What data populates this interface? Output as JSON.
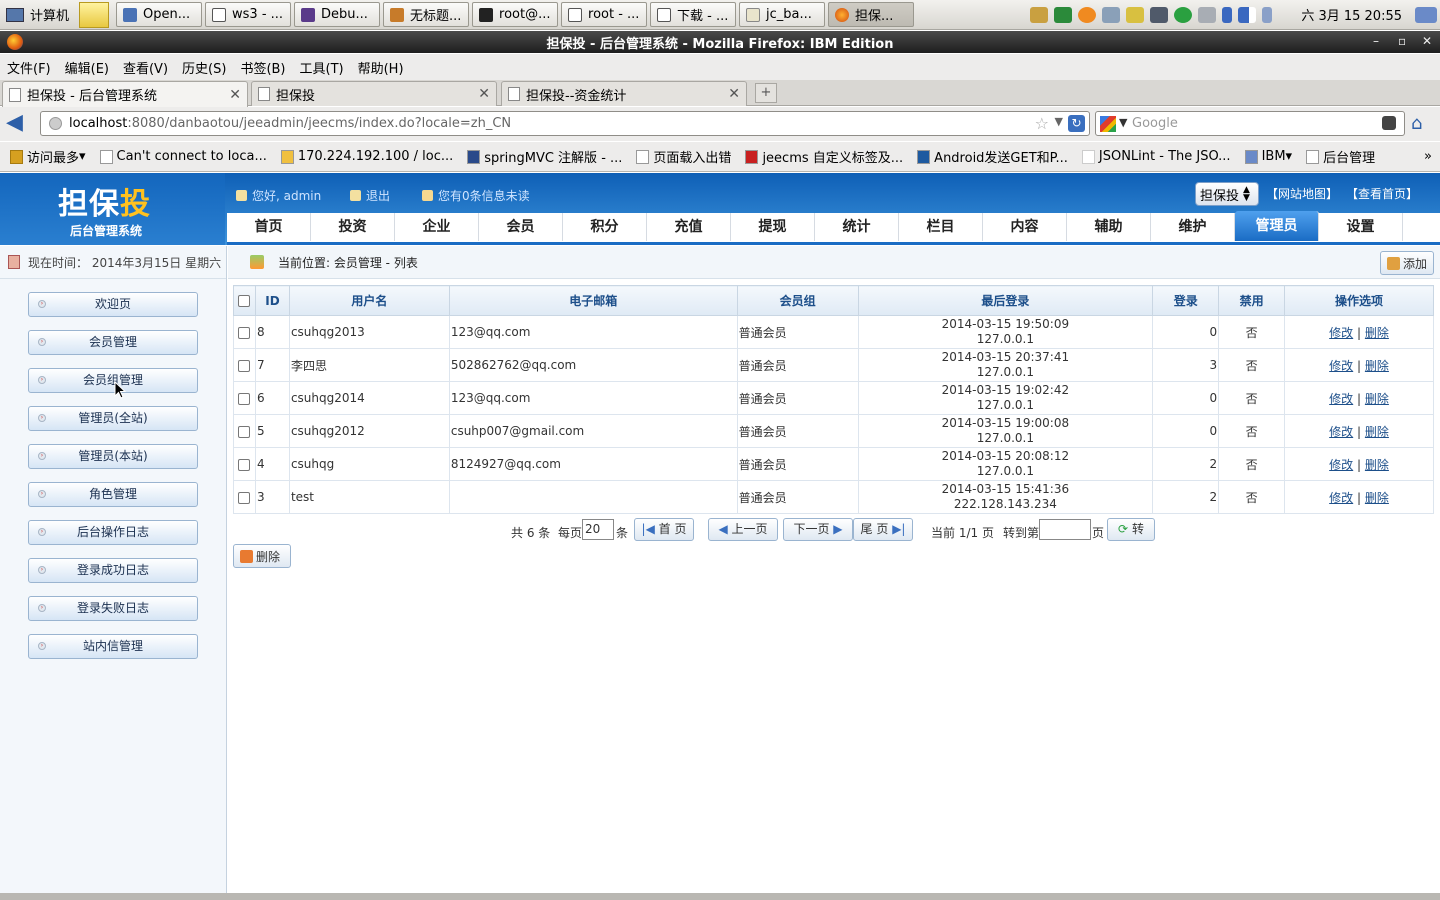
{
  "panel": {
    "computer": "计算机",
    "tasks": [
      "Open...",
      "ws3 - ...",
      "Debu...",
      "无标题...",
      "root@...",
      "root - ...",
      "下载 - ...",
      "jc_ba...",
      "担保..."
    ],
    "clock": "六 3月 15 20:55"
  },
  "window": {
    "title": "担保投 - 后台管理系统 - Mozilla Firefox: IBM Edition"
  },
  "menu": [
    "文件(F)",
    "编辑(E)",
    "查看(V)",
    "历史(S)",
    "书签(B)",
    "工具(T)",
    "帮助(H)"
  ],
  "tabs": [
    "担保投 - 后台管理系统",
    "担保投",
    "担保投--资金统计"
  ],
  "address": {
    "host": "localhost",
    "rest": ":8080/danbaotou/jeeadmin/jeecms/index.do?locale=zh_CN"
  },
  "search": {
    "placeholder": "Google"
  },
  "bookmarks": [
    "访问最多",
    "Can't connect to loca...",
    "170.224.192.100 / loc...",
    "springMVC 注解版 - ...",
    "页面载入出错",
    "jeecms 自定义标签及...",
    "Android发送GET和P...",
    "JSONLint - The JSO...",
    "IBM",
    "后台管理"
  ],
  "header": {
    "logo_a": "担保",
    "logo_b": "投",
    "logo_sub": "后台管理系统",
    "greeting": "您好, admin",
    "logout": "退出",
    "messages": "您有0条信息未读",
    "site_select": "担保投",
    "sitemap": "【网站地图】",
    "view_home": "【查看首页】"
  },
  "nav": [
    "首页",
    "投资",
    "企业",
    "会员",
    "积分",
    "充值",
    "提现",
    "统计",
    "栏目",
    "内容",
    "辅助",
    "维护",
    "管理员",
    "设置"
  ],
  "sidebar": {
    "time_label": "现在时间：",
    "time_value": "2014年3月15日 星期六",
    "items": [
      "欢迎页",
      "会员管理",
      "会员组管理",
      "管理员(全站)",
      "管理员(本站)",
      "角色管理",
      "后台操作日志",
      "登录成功日志",
      "登录失败日志",
      "站内信管理"
    ]
  },
  "main": {
    "breadcrumb": "当前位置: 会员管理 - 列表",
    "add_label": "添加",
    "columns": [
      "ID",
      "用户名",
      "电子邮箱",
      "会员组",
      "最后登录",
      "登录",
      "禁用",
      "操作选项"
    ],
    "rows": [
      {
        "id": "8",
        "user": "csuhqg2013",
        "email": "123@qq.com",
        "group": "普通会员",
        "time": "2014-03-15 19:50:09",
        "ip": "127.0.0.1",
        "logins": "0",
        "disabled": "否"
      },
      {
        "id": "7",
        "user": "李四思",
        "email": "502862762@qq.com",
        "group": "普通会员",
        "time": "2014-03-15 20:37:41",
        "ip": "127.0.0.1",
        "logins": "3",
        "disabled": "否"
      },
      {
        "id": "6",
        "user": "csuhqg2014",
        "email": "123@qq.com",
        "group": "普通会员",
        "time": "2014-03-15 19:02:42",
        "ip": "127.0.0.1",
        "logins": "0",
        "disabled": "否"
      },
      {
        "id": "5",
        "user": "csuhqg2012",
        "email": "csuhp007@gmail.com",
        "group": "普通会员",
        "time": "2014-03-15 19:00:08",
        "ip": "127.0.0.1",
        "logins": "0",
        "disabled": "否"
      },
      {
        "id": "4",
        "user": "csuhqg",
        "email": "8124927@qq.com",
        "group": "普通会员",
        "time": "2014-03-15 20:08:12",
        "ip": "127.0.0.1",
        "logins": "2",
        "disabled": "否"
      },
      {
        "id": "3",
        "user": "test",
        "email": "",
        "group": "普通会员",
        "time": "2014-03-15 15:41:36",
        "ip": "222.128.143.234",
        "logins": "2",
        "disabled": "否"
      }
    ],
    "edit": "修改",
    "del": "删除",
    "sep": "|",
    "pager": {
      "total": "共 6 条",
      "per_page": "每页",
      "per_value": "20",
      "unit": "条",
      "first": "首 页",
      "prev": "上一页",
      "next": "下一页",
      "last": "尾 页",
      "current": "当前 1/1 页",
      "goto": "转到第",
      "page_unit": "页",
      "go": "转"
    },
    "delete_label": "删除"
  }
}
